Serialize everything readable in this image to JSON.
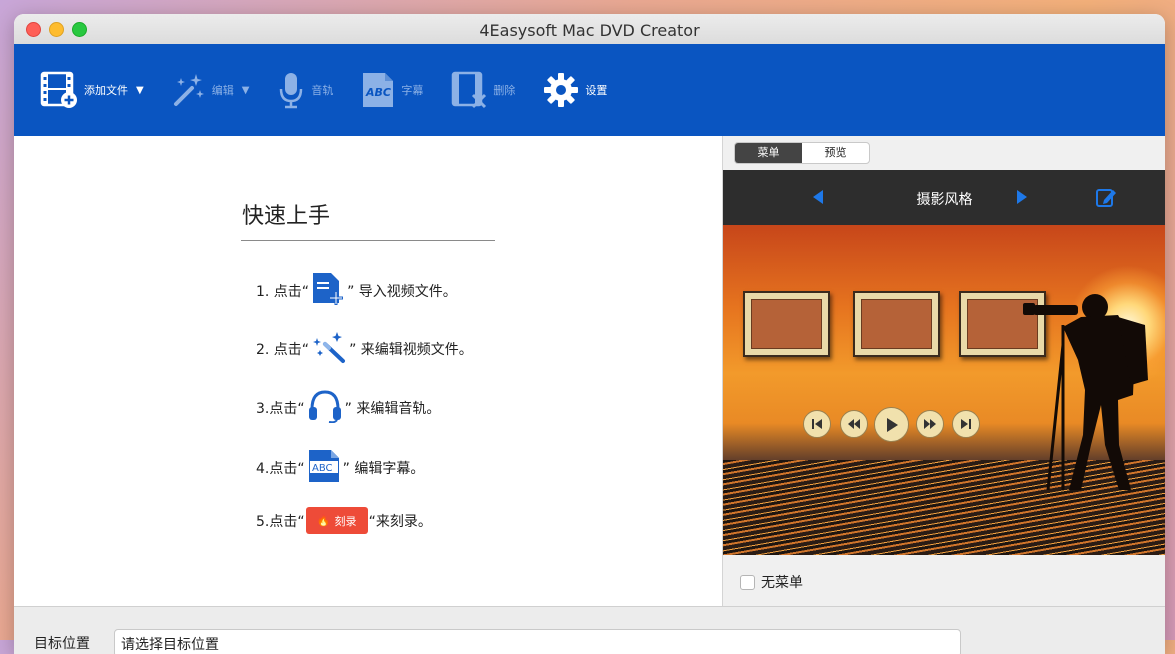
{
  "window": {
    "title": "4Easysoft Mac DVD Creator"
  },
  "toolbar": {
    "add_file": "添加文件",
    "edit": "编辑",
    "audio": "音轨",
    "subtitle": "字幕",
    "delete": "删除",
    "settings": "设置"
  },
  "quickstart": {
    "title": "快速上手",
    "steps": [
      {
        "prefix": "1. 点击“",
        "suffix": "” 导入视频文件。",
        "icon": "add-file-icon"
      },
      {
        "prefix": "2. 点击“",
        "suffix": "” 来编辑视频文件。",
        "icon": "magic-wand-icon"
      },
      {
        "prefix": "3.点击“",
        "suffix": "” 来编辑音轨。",
        "icon": "headphones-icon"
      },
      {
        "prefix": "4.点击“",
        "suffix": "” 编辑字幕。",
        "icon": "abc-subtitle-icon"
      },
      {
        "prefix": "5.点击“",
        "suffix": "“来刻录。",
        "icon": "burn-button-icon"
      }
    ],
    "burn_label": "刻录"
  },
  "menu_panel": {
    "tabs": {
      "menu": "菜单",
      "preview": "预览"
    },
    "active_tab": "menu",
    "theme_name": "摄影风格",
    "no_menu_label": "无菜单",
    "no_menu_checked": false
  },
  "destination": {
    "label": "目标位置",
    "placeholder": "请选择目标位置"
  },
  "colors": {
    "toolbar": "#0a55c1",
    "burn": "#ee4b38",
    "accent": "#1e78e8"
  }
}
